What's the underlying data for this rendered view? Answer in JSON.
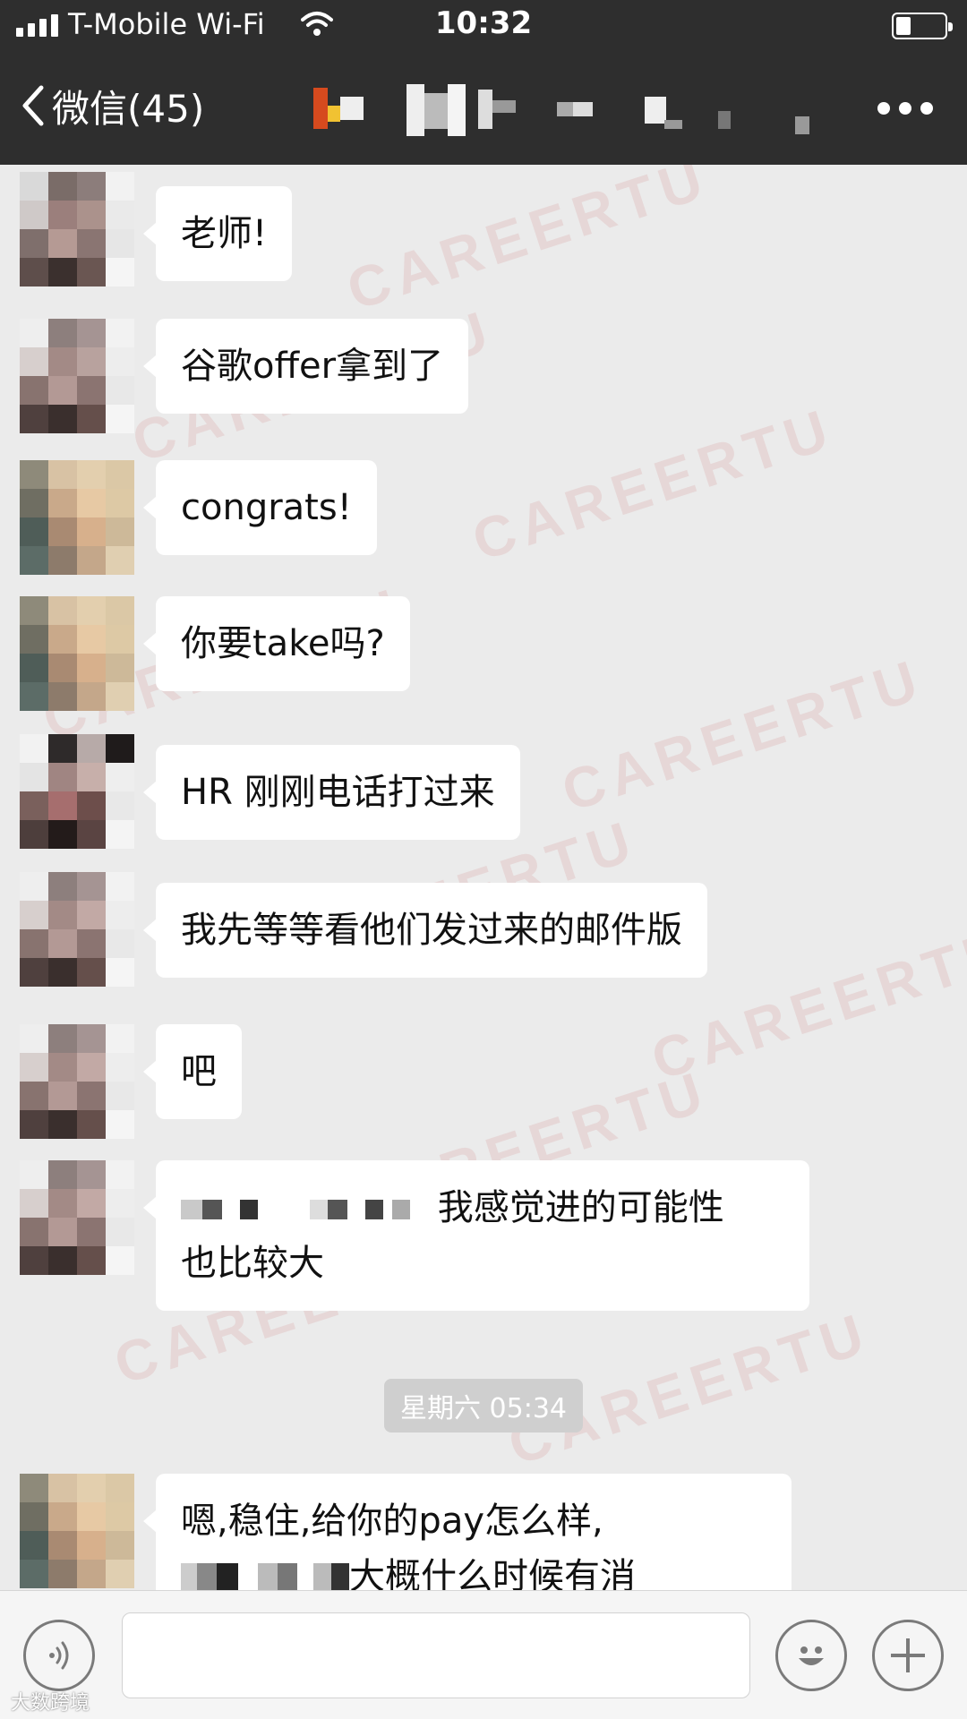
{
  "status_bar": {
    "carrier": "T-Mobile Wi-Fi",
    "time": "10:32"
  },
  "nav": {
    "back_label": "微信(45)",
    "title": "",
    "more_icon": "more-dots-icon"
  },
  "messages": [
    {
      "sender": "student",
      "text": "老师!"
    },
    {
      "sender": "student",
      "text": "谷歌offer拿到了"
    },
    {
      "sender": "teacher",
      "text": "congrats!"
    },
    {
      "sender": "teacher",
      "text": "你要take吗?"
    },
    {
      "sender": "student",
      "text": "HR 刚刚电话打过来"
    },
    {
      "sender": "student",
      "text": "我先等等看他们发过来的邮件版"
    },
    {
      "sender": "student",
      "text": "吧"
    },
    {
      "sender": "student",
      "text_line1_suffix": "我感觉进的可能性",
      "text_line2": "也比较大"
    },
    {
      "sender": "teacher",
      "text_line1": "嗯,稳住,给你的pay怎么样,",
      "text_line2_suffix": "大概什么时候有消"
    }
  ],
  "time_divider": "星期六 05:34",
  "watermark": "CAREERTU",
  "input_bar": {
    "voice_icon": "voice-icon",
    "emoji_icon": "emoji-icon",
    "plus_icon": "plus-icon",
    "input_value": ""
  },
  "footer_brand": "大数跨境",
  "colors": {
    "nav_bg": "#2e2e2e",
    "chat_bg": "#ebebeb",
    "bubble": "#ffffff"
  }
}
